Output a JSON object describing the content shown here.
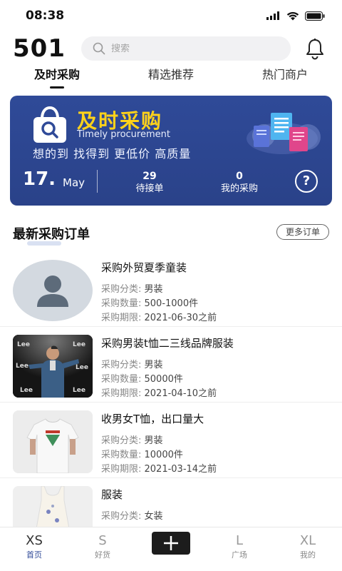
{
  "status_bar": {
    "time": "08:38"
  },
  "header": {
    "brand": "501",
    "search_placeholder": "搜索"
  },
  "tabs": [
    {
      "label": "及时采购",
      "active": true
    },
    {
      "label": "精选推荐",
      "active": false
    },
    {
      "label": "热门商户",
      "active": false
    }
  ],
  "banner": {
    "title": "及时采购",
    "subtitle": "Timely procurement",
    "slogan": "想的到 找得到 更低价 高质量",
    "date_day": "17.",
    "date_month": "May",
    "stats": [
      {
        "value": "29",
        "label": "待接单"
      },
      {
        "value": "0",
        "label": "我的采购"
      }
    ],
    "help_symbol": "?",
    "title_color": "#ffd21a",
    "background_color": "#2f4a98"
  },
  "section": {
    "title": "最新采购订单",
    "more_label": "更多订单"
  },
  "orders": [
    {
      "title": "采购外贸夏季童装",
      "category_key": "采购分类: ",
      "category": "男装",
      "qty_key": "采购数量: ",
      "qty": "500-1000件",
      "deadline_key": "采购期限: ",
      "deadline": "2021-06-30之前",
      "image": "avatar-placeholder"
    },
    {
      "title": "采购男装t恤二三线品牌服装",
      "category_key": "采购分类: ",
      "category": "男装",
      "qty_key": "采购数量: ",
      "qty": "50000件",
      "deadline_key": "采购期限: ",
      "deadline": "2021-04-10之前",
      "image": "man-photo"
    },
    {
      "title": "收男女T恤，出口量大",
      "category_key": "采购分类: ",
      "category": "男装",
      "qty_key": "采购数量: ",
      "qty": "10000件",
      "deadline_key": "采购期限: ",
      "deadline": "2021-03-14之前",
      "image": "tshirt-photo"
    },
    {
      "title": "服装",
      "category_key": "采购分类: ",
      "category": "女装",
      "qty_key": "采购数量: ",
      "qty": "",
      "deadline_key": "",
      "deadline": "",
      "image": "dress-photo"
    }
  ],
  "bottom_nav": [
    {
      "big": "XS",
      "small": "首页",
      "active": true
    },
    {
      "big": "S",
      "small": "好货",
      "active": false
    },
    {
      "big": "",
      "small": "",
      "active": false,
      "add": true
    },
    {
      "big": "L",
      "small": "广场",
      "active": false
    },
    {
      "big": "XL",
      "small": "我的",
      "active": false
    }
  ]
}
